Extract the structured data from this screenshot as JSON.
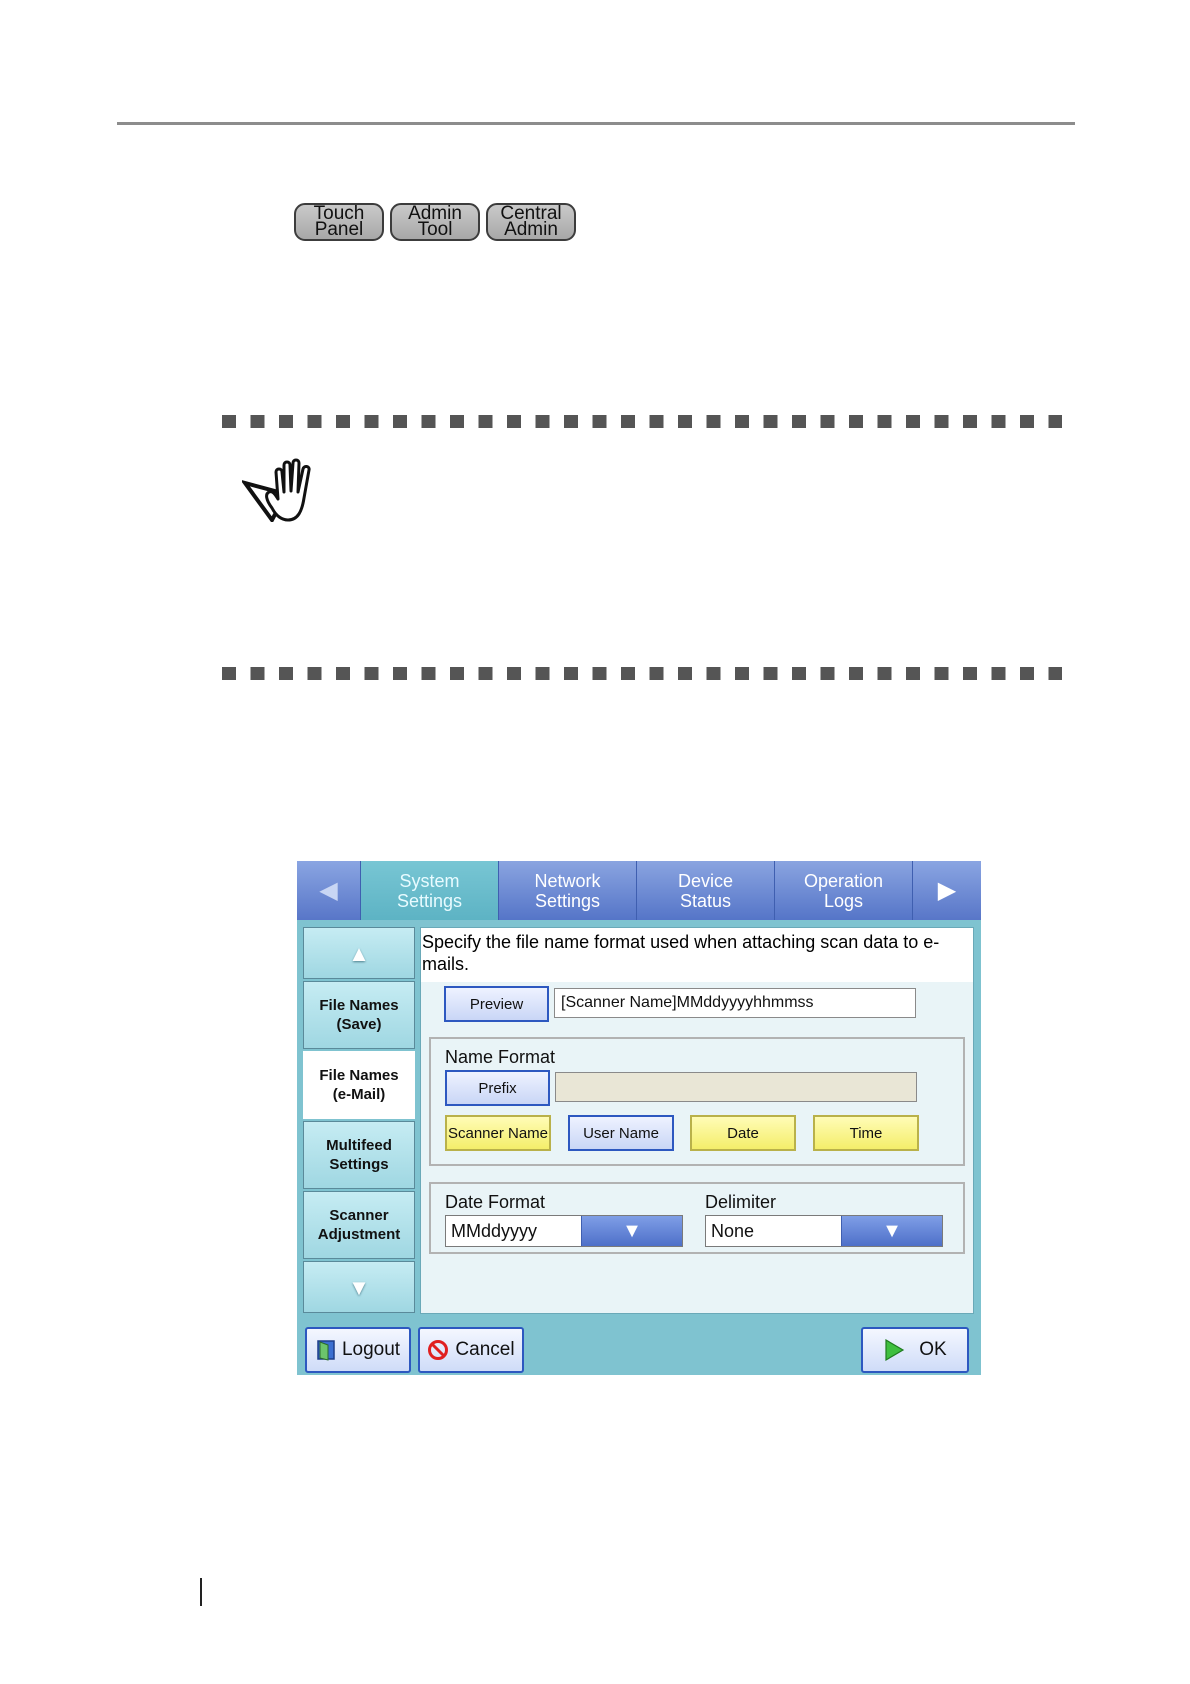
{
  "badges": [
    {
      "line1": "Touch",
      "line2": "Panel"
    },
    {
      "line1": "Admin",
      "line2": "Tool"
    },
    {
      "line1": "Central",
      "line2": "Admin"
    }
  ],
  "ui": {
    "tabs": [
      {
        "line1": "System",
        "line2": "Settings"
      },
      {
        "line1": "Network",
        "line2": "Settings"
      },
      {
        "line1": "Device",
        "line2": "Status"
      },
      {
        "line1": "Operation",
        "line2": "Logs"
      }
    ],
    "tab_prev_glyph": "◀",
    "tab_next_glyph": "▶",
    "sidebar": {
      "up_glyph": "▲",
      "down_glyph": "▼",
      "items": [
        {
          "line1": "File Names",
          "line2": "(Save)"
        },
        {
          "line1": "File Names",
          "line2": "(e-Mail)"
        },
        {
          "line1": "Multifeed",
          "line2": "Settings"
        },
        {
          "line1": "Scanner",
          "line2": "Adjustment"
        }
      ]
    },
    "description": "Specify the file name format used when attaching scan data to e-mails.",
    "preview": {
      "button": "Preview",
      "value": "[Scanner Name]MMddyyyyhhmmss"
    },
    "name_format": {
      "label": "Name Format",
      "prefix_button": "Prefix",
      "prefix_value": "",
      "items": [
        "Scanner Name",
        "User Name",
        "Date",
        "Time"
      ]
    },
    "date_format": {
      "label": "Date Format",
      "value": "MMddyyyy"
    },
    "delimiter": {
      "label": "Delimiter",
      "value": "None"
    },
    "dropdown_glyph": "▼",
    "footer": {
      "logout": "Logout",
      "cancel": "Cancel",
      "ok": "OK"
    },
    "colors": {
      "tab_blue": "#5575c8",
      "panel_teal": "#7fc3d0",
      "yellow_button": "#f4ee6a"
    }
  }
}
